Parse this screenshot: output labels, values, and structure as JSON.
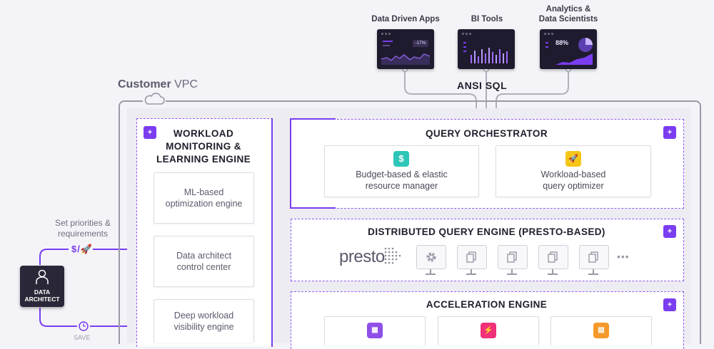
{
  "apps": [
    {
      "label": "Data Driven Apps",
      "value": "-17%"
    },
    {
      "label": "BI Tools"
    },
    {
      "label": "Analytics &\nData Scientists",
      "value": "88%"
    }
  ],
  "ansi_sql": "ANSI SQL",
  "vpc": {
    "bold": "Customer",
    "rest": " VPC"
  },
  "workload": {
    "title_lines": [
      "WORKLOAD",
      "MONITORING &",
      "LEARNING ENGINE"
    ],
    "cards": [
      {
        "lines": [
          "ML-based",
          "optimization engine"
        ]
      },
      {
        "lines": [
          "Data architect",
          "control center"
        ]
      },
      {
        "lines": [
          "Deep workload",
          "visibility engine"
        ]
      }
    ]
  },
  "orchestrator": {
    "title": "QUERY ORCHESTRATOR",
    "cards": [
      {
        "icon": "$",
        "lines": [
          "Budget-based & elastic",
          "resource manager"
        ]
      },
      {
        "icon": "🚀",
        "lines": [
          "Workload-based",
          "query optimizer"
        ]
      }
    ]
  },
  "distributed": {
    "title": "DISTRIBUTED QUERY ENGINE (PRESTO-BASED)",
    "logo": "presto",
    "more": "•••"
  },
  "acceleration": {
    "title": "ACCELERATION  ENGINE"
  },
  "architect": {
    "line1": "DATA",
    "line2": "ARCHITECT"
  },
  "priorities": {
    "lines": [
      "Set priorities &",
      "requirements"
    ],
    "symbols": "$/🚀"
  },
  "bottom_cut": "SAVE",
  "colors": {
    "purple": "#7a3df0",
    "teal": "#2ec6b8",
    "yellow": "#f5c518",
    "pink": "#f0307a",
    "orange": "#f59a2a"
  }
}
